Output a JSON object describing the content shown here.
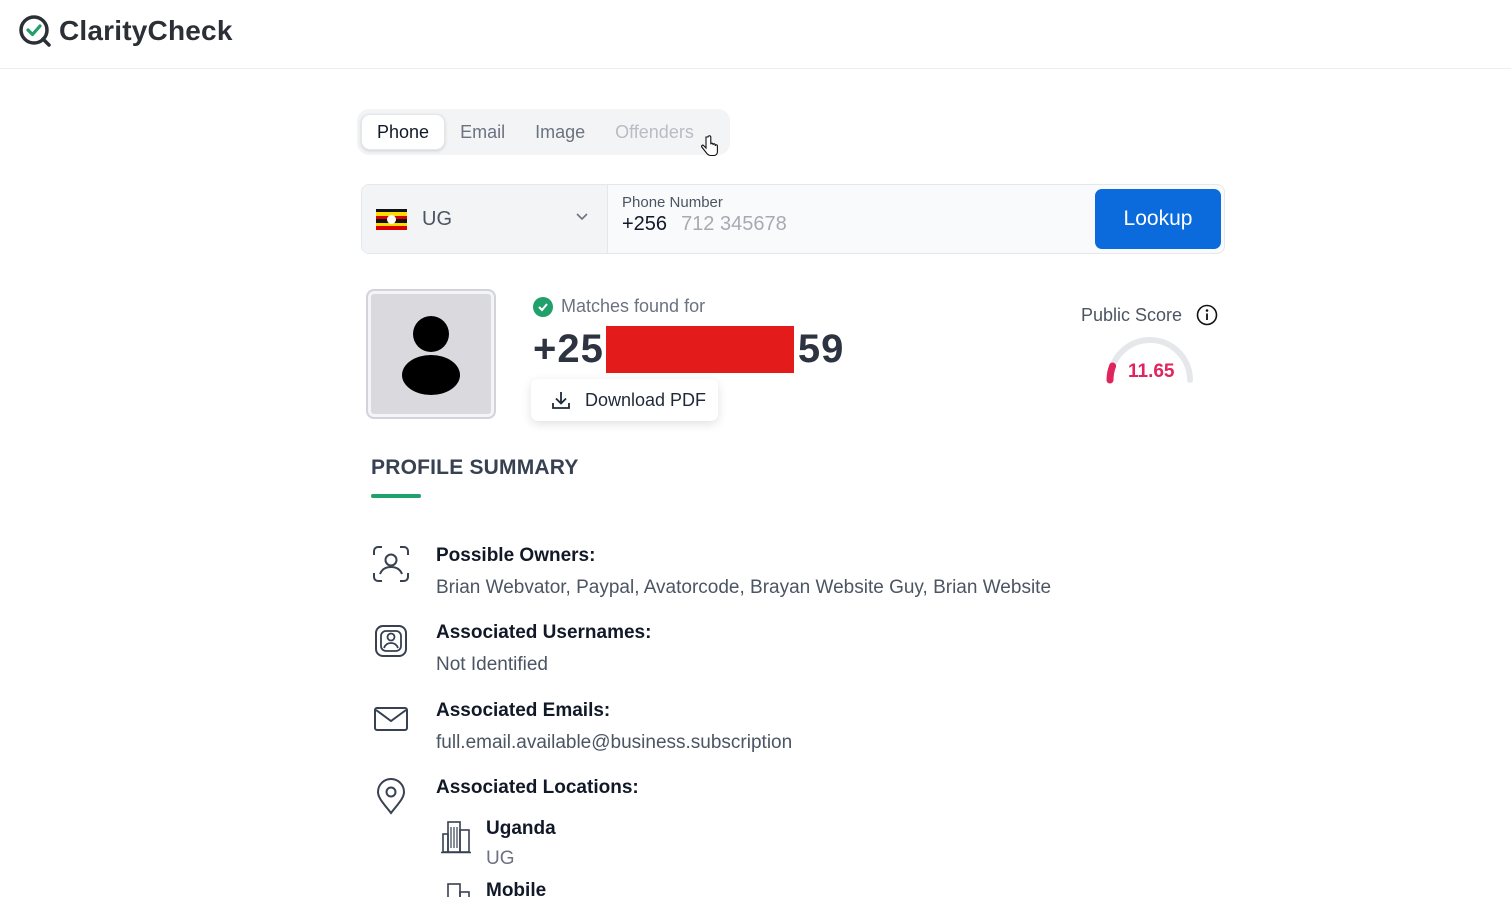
{
  "app": {
    "brand": "ClarityCheck"
  },
  "tabs": [
    {
      "label": "Phone",
      "active": true
    },
    {
      "label": "Email",
      "active": false
    },
    {
      "label": "Image",
      "active": false
    },
    {
      "label": "Offenders",
      "active": false
    }
  ],
  "search": {
    "country_code": "UG",
    "phone_label": "Phone Number",
    "prefix": "+256",
    "placeholder": "712 345678",
    "lookup_label": "Lookup"
  },
  "result": {
    "matches_label": "Matches found for",
    "number_start": "+25",
    "number_end": "59",
    "download_label": "Download PDF"
  },
  "score": {
    "label": "Public Score",
    "value": "11.65",
    "accent": "#e0245e"
  },
  "profile": {
    "section_title": "PROFILE SUMMARY",
    "owners_title": "Possible Owners:",
    "owners_value": "Brian Webvator, Paypal, Avatorcode, Brayan Website Guy, Brian Website",
    "usernames_title": "Associated Usernames:",
    "usernames_value": "Not Identified",
    "emails_title": "Associated Emails:",
    "emails_value": "full.email.available@business.subscription",
    "locations_title": "Associated Locations:",
    "locations": [
      {
        "name": "Uganda",
        "code": "UG"
      },
      {
        "name": "Mobile",
        "code": ""
      }
    ]
  },
  "colors": {
    "primary": "#0b6bdc",
    "success": "#22a06b",
    "redaction": "#e41b1b"
  }
}
